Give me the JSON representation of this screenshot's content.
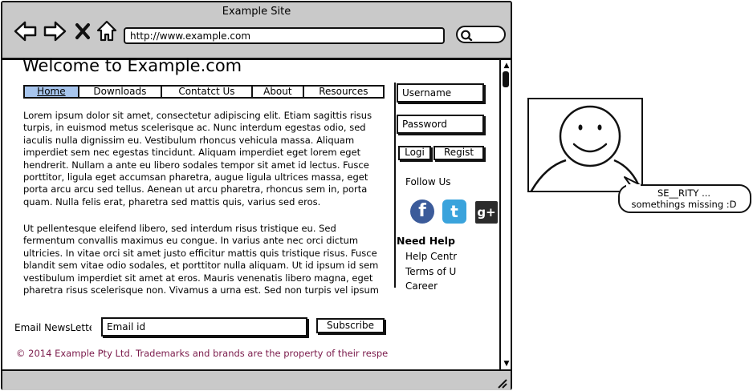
{
  "window": {
    "title": "Example Site"
  },
  "toolbar": {
    "url": "http://www.example.com",
    "icons": [
      "back-arrow-icon",
      "forward-arrow-icon",
      "close-x-icon",
      "home-icon",
      "search-icon"
    ]
  },
  "page": {
    "heading": "Welcome to Example.com",
    "tabs": [
      {
        "label": "Home",
        "active": true
      },
      {
        "label": "Downloads",
        "active": false
      },
      {
        "label": "Contatct Us",
        "active": false
      },
      {
        "label": "About",
        "active": false
      },
      {
        "label": "Resources",
        "active": false
      }
    ],
    "paragraph1": " Lorem ipsum dolor sit amet, consectetur adipiscing elit. Etiam sagittis risus turpis, in euismod metus scelerisque ac. Nunc interdum egestas odio, sed iaculis nulla dignissim eu. Vestibulum rhoncus vehicula massa. Aliquam imperdiet sem nec egestas tincidunt. Aliquam imperdiet eget lorem eget hendrerit. Nullam a ante eu libero sodales tempor sit amet id lectus. Fusce porttitor, ligula eget accumsan pharetra, augue ligula ultrices massa, eget porta arcu arcu sed tellus. Aenean ut arcu pharetra, rhoncus sem in, porta quam. Nulla felis erat, pharetra sed mattis quis, varius sed eros.",
    "paragraph2": "Ut pellentesque eleifend libero, sed interdum risus tristique eu. Sed fermentum convallis maximus eu congue. In varius ante nec orci dictum ultricies. In vitae orci sit amet justo efficitur mattis quis tristique risus. Fusce blandit sem vitae odio sodales, et porttitor nulla aliquam. Ut id ipsum id sem vestibulum imperdiet sit amet at eros. Mauris venenatis libero magna, eget pharetra risus scelerisque non. Vivamus a urna est. Sed non turpis vel ipsum"
  },
  "sidebar": {
    "username_placeholder": "Username",
    "password_placeholder": "Password",
    "login_label": "Logi",
    "register_label": "Regist",
    "follow_label": "Follow Us",
    "social": [
      {
        "name": "facebook",
        "glyph": "f",
        "color": "#3b5b9a"
      },
      {
        "name": "twitter",
        "glyph": "t",
        "color": "#3aa3dc"
      },
      {
        "name": "google-plus",
        "glyph": "g+",
        "color": "#2b2b2b"
      }
    ],
    "help_heading": "Need Help",
    "help_links": [
      "Help Centr",
      "Terms of Us",
      "Career"
    ]
  },
  "newsletter": {
    "label": "Email NewsLette",
    "email_placeholder": "Email id",
    "subscribe_label": "Subscribe"
  },
  "footer": {
    "text": "© 2014 Example Pty Ltd. Trademarks and brands are the property of their respe"
  },
  "annotation": {
    "bubble_line1": "SE__RITY ...",
    "bubble_line2": "somethings missing :D"
  },
  "colors": {
    "chrome": "#c9c9c9",
    "active_tab": "#a8c6ee",
    "footer_text": "#7a1a4a"
  }
}
